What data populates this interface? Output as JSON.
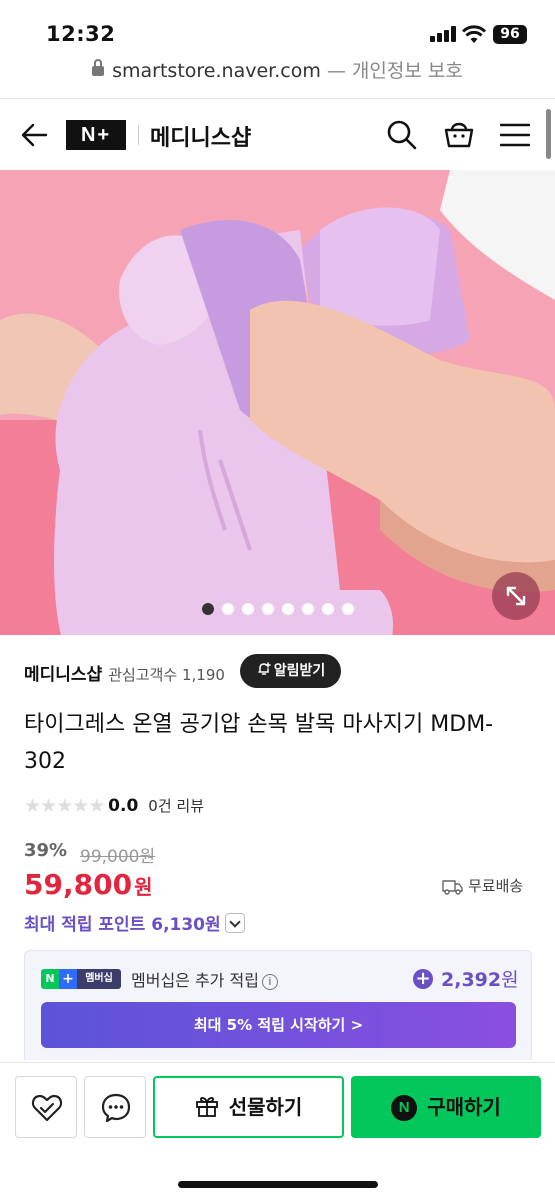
{
  "status_bar": {
    "time": "12:32",
    "battery": "96"
  },
  "url_bar": {
    "url": "smartstore.naver.com",
    "suffix": "— 개인정보 보호"
  },
  "header": {
    "logo": "N+",
    "store_name": "메디니스샵"
  },
  "gallery": {
    "total_images": 8,
    "active_index": 0
  },
  "store": {
    "name": "메디니스샵",
    "fans_label": "관심고객수 1,190",
    "alarm_label": "알림받기"
  },
  "product": {
    "title": "타이그레스 온열 공기압 손목 발목 마사지기 MDM-302",
    "rating": {
      "stars": "★★★★★",
      "score": "0.0",
      "reviews": "0건 리뷰"
    },
    "discount": "39%",
    "original_price": "99,000원",
    "price": "59,800",
    "price_unit": "원",
    "shipping": "무료배송",
    "points": "최대 적립 포인트 6,130원"
  },
  "membership": {
    "badge_n": "N",
    "badge_plus": "+",
    "badge_label": "멤버십",
    "desc": "멤버십은 추가 적립",
    "info": "i",
    "plus": "+",
    "bonus": "2,392",
    "bonus_unit": "원",
    "cta": "최대 5% 적립 시작하기 >"
  },
  "bottom_bar": {
    "gift_label": "선물하기",
    "buy_logo": "N",
    "buy_label": "구매하기"
  },
  "colors": {
    "naver_green": "#03c75a",
    "price_red": "#e2263f",
    "purple": "#6a4fc5",
    "hero_pink": "#f7a3b6"
  }
}
